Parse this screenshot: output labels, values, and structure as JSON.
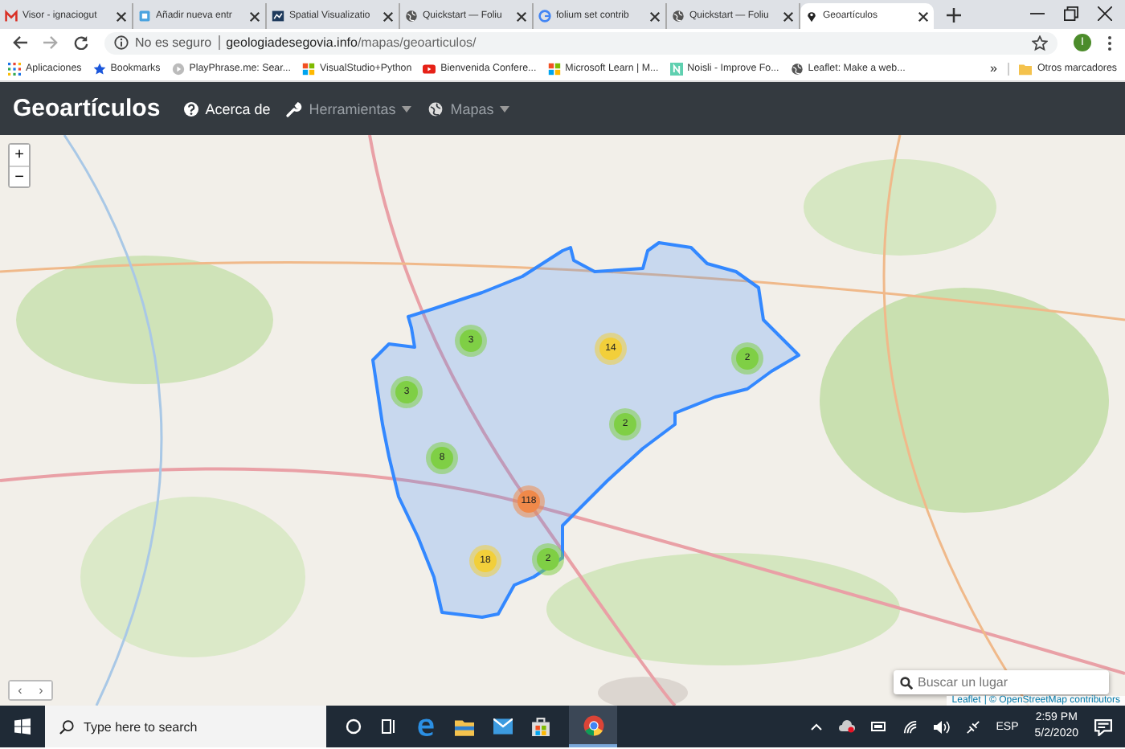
{
  "browser": {
    "tabs": [
      {
        "title": "Visor - ignaciogut",
        "kind": "mail",
        "selected": false
      },
      {
        "title": "Añadir nueva entr",
        "kind": "document",
        "selected": false
      },
      {
        "title": "Spatial Visualizatio",
        "kind": "chart",
        "selected": false
      },
      {
        "title": "Quickstart — Foliu",
        "kind": "globe",
        "selected": false
      },
      {
        "title": "folium set contrib",
        "kind": "google",
        "selected": false
      },
      {
        "title": "Quickstart — Foliu",
        "kind": "globe",
        "selected": false
      },
      {
        "title": "Geoartículos",
        "kind": "pin",
        "selected": true
      }
    ],
    "address": {
      "security": "No es seguro",
      "domain": "geologiadesegovia.info",
      "path": "/mapas/geoarticulos/"
    },
    "profile_initial": "I",
    "bookmarks": [
      {
        "label": "Aplicaciones",
        "kind": "apps"
      },
      {
        "label": "Bookmarks",
        "kind": "star"
      },
      {
        "label": "PlayPhrase.me: Sear...",
        "kind": "play"
      },
      {
        "label": "VisualStudio+Python",
        "kind": "windows"
      },
      {
        "label": "Bienvenida Confere...",
        "kind": "video"
      },
      {
        "label": "Microsoft Learn | M...",
        "kind": "windows"
      },
      {
        "label": "Noisli - Improve Fo...",
        "kind": "noisli"
      },
      {
        "label": "Leaflet: Make a web...",
        "kind": "globe"
      }
    ],
    "bookmarks_overflow": "»",
    "other_bookmarks": "Otros marcadores"
  },
  "navbar": {
    "brand": "Geoartículos",
    "items": [
      {
        "label": "Acerca de",
        "kind": "question",
        "dropdown": false,
        "active": true
      },
      {
        "label": "Herramientas",
        "kind": "wrench",
        "dropdown": true,
        "active": false
      },
      {
        "label": "Mapas",
        "kind": "globe",
        "dropdown": true,
        "active": false
      }
    ]
  },
  "map": {
    "zoom_in": "+",
    "zoom_out": "−",
    "nav_arrows": [
      "‹",
      "›"
    ],
    "clusters": [
      {
        "count": "3",
        "color": "#7fcf45"
      },
      {
        "count": "14",
        "color": "#f2cf3a"
      },
      {
        "count": "2",
        "color": "#7fcf45"
      },
      {
        "count": "3",
        "color": "#7fcf45"
      },
      {
        "count": "2",
        "color": "#7fcf45"
      },
      {
        "count": "8",
        "color": "#7fcf45"
      },
      {
        "count": "118",
        "color": "#f0894a"
      },
      {
        "count": "18",
        "color": "#f2cf3a"
      },
      {
        "count": "2",
        "color": "#7fcf45"
      }
    ],
    "search": {
      "placeholder": "Buscar un lugar"
    },
    "attribution": {
      "link": "Leaflet",
      "text": "| © OpenStreetMap contributors"
    }
  },
  "taskbar": {
    "search_placeholder": "Type here to search",
    "language": "ESP",
    "time": "2:59 PM",
    "date": "5/2/2020"
  }
}
